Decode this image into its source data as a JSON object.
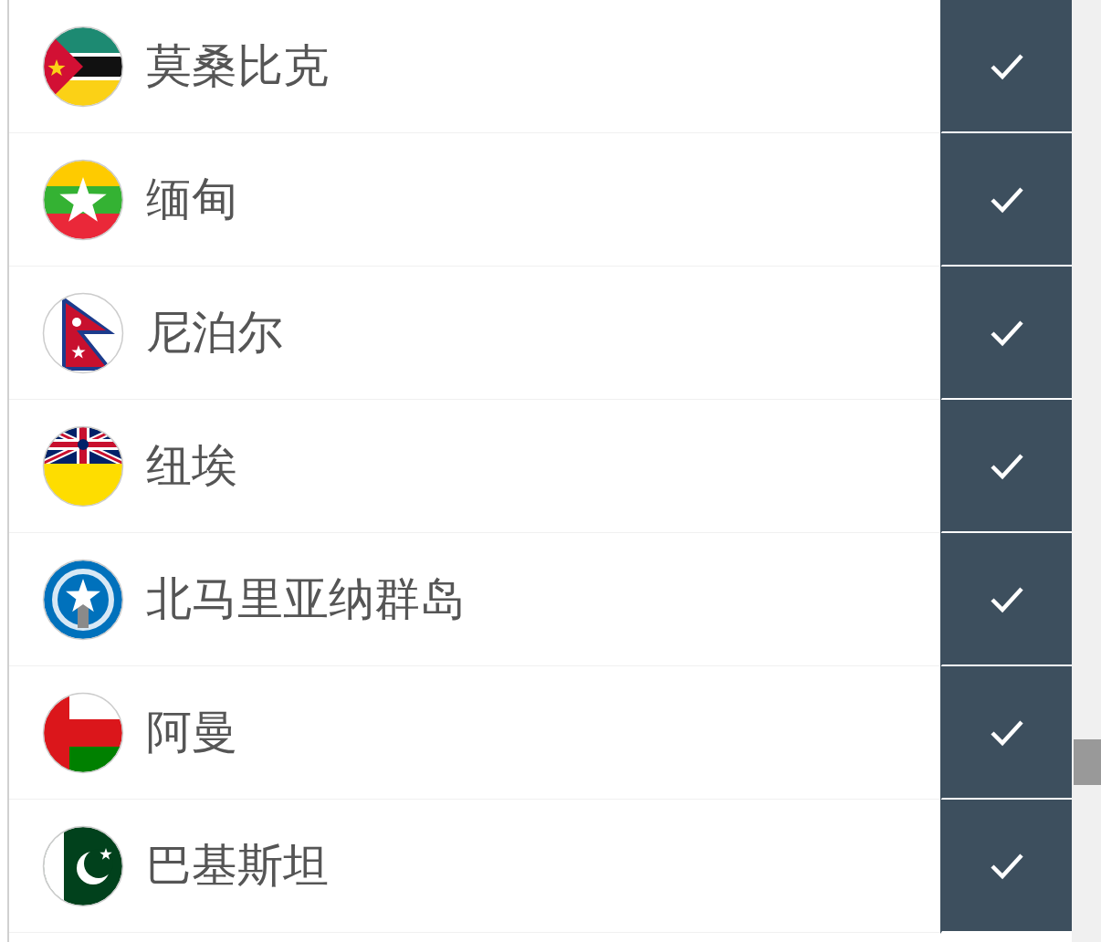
{
  "rows": [
    {
      "name": "莫桑比克",
      "checked": true
    },
    {
      "name": "缅甸",
      "checked": true
    },
    {
      "name": "尼泊尔",
      "checked": true
    },
    {
      "name": "纽埃",
      "checked": true
    },
    {
      "name": "北马里亚纳群岛",
      "checked": true
    },
    {
      "name": "阿曼",
      "checked": true
    },
    {
      "name": "巴基斯坦",
      "checked": true
    }
  ]
}
